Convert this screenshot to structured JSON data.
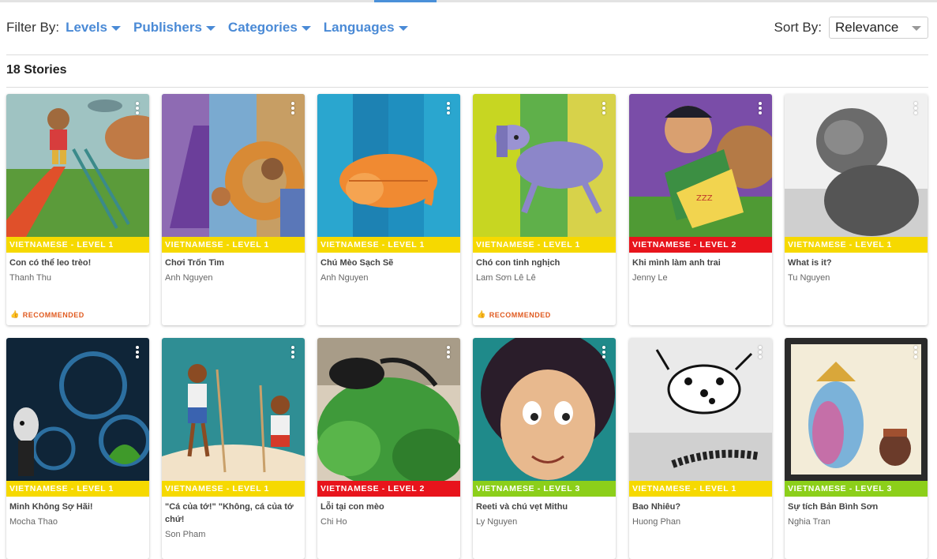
{
  "filter": {
    "label": "Filter By:",
    "options": [
      "Levels",
      "Publishers",
      "Categories",
      "Languages"
    ]
  },
  "sort": {
    "label": "Sort By:",
    "value": "Relevance"
  },
  "stories_count": "18 Stories",
  "colors": {
    "yellow": "#f6d900",
    "red": "#e8141c",
    "green": "#8ccf1a",
    "accent": "#4a8ad6",
    "recommended": "#e05a1f"
  },
  "cards": [
    {
      "level": "VIETNAMESE - LEVEL 1",
      "level_color": "yellow",
      "title": "Con có thể leo trèo!",
      "author": "Thanh Thu",
      "recommended": "RECOMMENDED"
    },
    {
      "level": "VIETNAMESE - LEVEL 1",
      "level_color": "yellow",
      "title": "Chơi Trốn Tìm",
      "author": "Anh Nguyen"
    },
    {
      "level": "VIETNAMESE - LEVEL 1",
      "level_color": "yellow",
      "title": "Chú Mèo Sạch Sẽ",
      "author": "Anh Nguyen"
    },
    {
      "level": "VIETNAMESE - LEVEL 1",
      "level_color": "yellow",
      "title": "Chó con tinh nghịch",
      "author": "Lam Sơn Lê Lê",
      "recommended": "RECOMMENDED"
    },
    {
      "level": "VIETNAMESE - LEVEL 2",
      "level_color": "red",
      "title": "Khi mình làm anh trai",
      "author": "Jenny Le"
    },
    {
      "level": "VIETNAMESE - LEVEL 1",
      "level_color": "yellow",
      "title": "What is it?",
      "author": "Tu Nguyen"
    },
    {
      "level": "VIETNAMESE - LEVEL 1",
      "level_color": "yellow",
      "title": "Minh Không Sợ Hãi!",
      "author": "Mocha Thao"
    },
    {
      "level": "VIETNAMESE - LEVEL 1",
      "level_color": "yellow",
      "title": "\"Cá của tớ!\" \"Không, cá của tớ chứ!",
      "author": "Son Pham"
    },
    {
      "level": "VIETNAMESE - LEVEL 2",
      "level_color": "red",
      "title": "Lỗi tại con mèo",
      "author": "Chi Ho"
    },
    {
      "level": "VIETNAMESE - LEVEL 3",
      "level_color": "green",
      "title": "Reeti và chú vẹt Mithu",
      "author": "Ly Nguyen"
    },
    {
      "level": "VIETNAMESE - LEVEL 1",
      "level_color": "yellow",
      "title": "Bao Nhiêu?",
      "author": "Huong Phan"
    },
    {
      "level": "VIETNAMESE - LEVEL 3",
      "level_color": "green",
      "title": "Sự tích Bản Bình Sơn",
      "author": "Nghia Tran"
    }
  ]
}
